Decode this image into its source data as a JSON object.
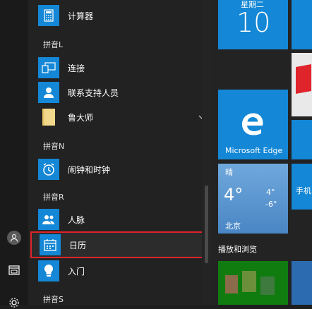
{
  "app_list": {
    "items": [
      {
        "label": "计算器",
        "icon": "calculator-icon"
      },
      {
        "header": "拼音L"
      },
      {
        "label": "连接",
        "icon": "connect-icon"
      },
      {
        "label": "联系支持人员",
        "icon": "contact-support-icon"
      },
      {
        "label": "鲁大师",
        "icon": "folder-icon",
        "expandable": true
      },
      {
        "header": "拼音N"
      },
      {
        "label": "闹钟和时钟",
        "icon": "alarm-clock-icon"
      },
      {
        "header": "拼音R"
      },
      {
        "label": "人脉",
        "icon": "people-icon"
      },
      {
        "label": "日历",
        "icon": "calendar-icon",
        "highlighted": true
      },
      {
        "label": "入门",
        "icon": "lightbulb-icon"
      },
      {
        "header": "拼音S"
      }
    ],
    "highlight_color": "#e0242b"
  },
  "tiles": {
    "calendar": {
      "day_name": "星期二",
      "day_number": "10"
    },
    "edge": {
      "label": "Microsoft Edge"
    },
    "weather": {
      "condition": "晴",
      "current_temp": "4°",
      "high": "4°",
      "low": "-6°",
      "city": "北京"
    },
    "group_label": "播放和浏览",
    "partial_tile_label": "手机"
  },
  "colors": {
    "accent": "#1487d6",
    "highlight": "#e0242b"
  }
}
